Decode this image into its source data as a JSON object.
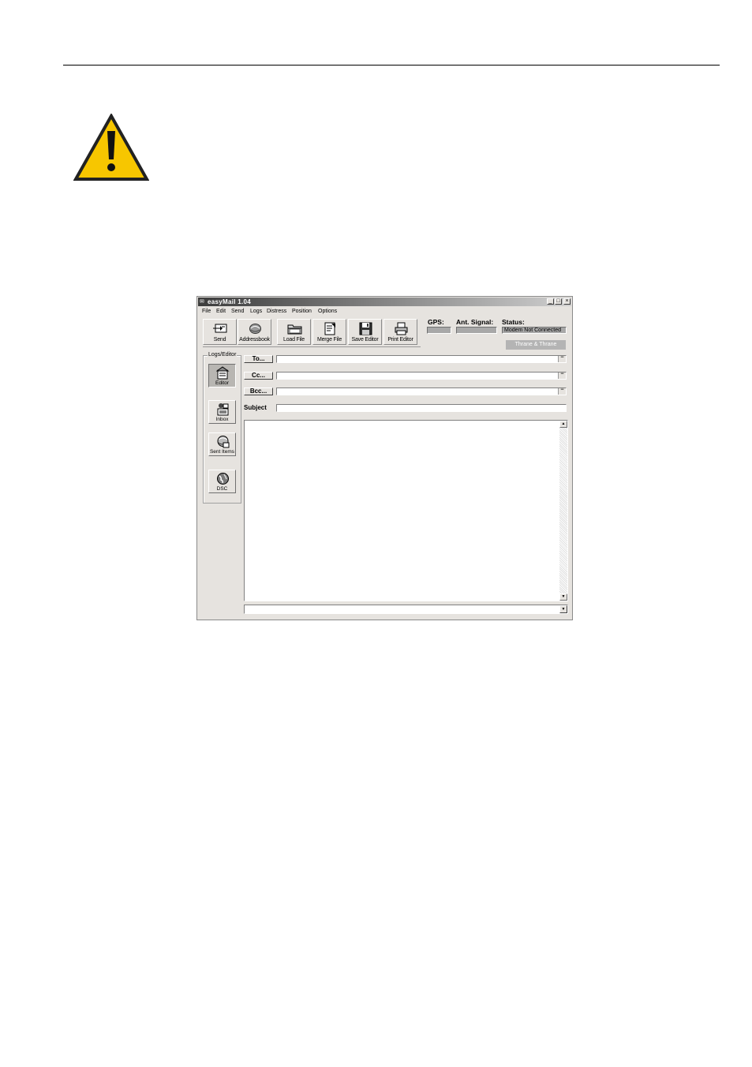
{
  "window": {
    "title": "easyMail  1.04",
    "controls": [
      "_",
      "□",
      "×"
    ]
  },
  "menu": [
    "File",
    "Edit",
    "Send",
    "Logs",
    "Distress",
    "Position",
    "Options"
  ],
  "toolbar": [
    {
      "label": "Send",
      "icon": "send-icon"
    },
    {
      "label": "Addressbook",
      "icon": "addressbook-icon"
    },
    {
      "label": "Load File",
      "icon": "folder-icon"
    },
    {
      "label": "Merge File",
      "icon": "merge-file-icon"
    },
    {
      "label": "Save Editor",
      "icon": "floppy-disk-icon"
    },
    {
      "label": "Print Editor",
      "icon": "printer-icon"
    }
  ],
  "status_panel": {
    "gps_label": "GPS:",
    "gps_value": "",
    "ant_label": "Ant. Signal:",
    "ant_value": "",
    "status_label": "Status:",
    "status_value": "Modem Not Connected",
    "thrane_button": "Thrane & Thrane"
  },
  "sidebar": {
    "group_label": "Logs/Editor",
    "items": [
      {
        "label": "Editor",
        "icon": "editor-icon",
        "selected": true
      },
      {
        "label": "Inbox",
        "icon": "inbox-icon",
        "selected": false
      },
      {
        "label": "Sent Items",
        "icon": "sent-items-icon",
        "selected": false
      },
      {
        "label": "DSC",
        "icon": "dsc-globe-icon",
        "selected": false
      }
    ]
  },
  "compose": {
    "to_label": "To...",
    "to_value": "",
    "cc_label": "Cc...",
    "cc_value": "",
    "bcc_label": "Bcc...",
    "bcc_value": "",
    "subject_label": "Subject",
    "subject_value": "",
    "body": "",
    "bottom_value": ""
  },
  "colors": {
    "warning_fill": "#f7c600",
    "window_face": "#e6e3df"
  }
}
